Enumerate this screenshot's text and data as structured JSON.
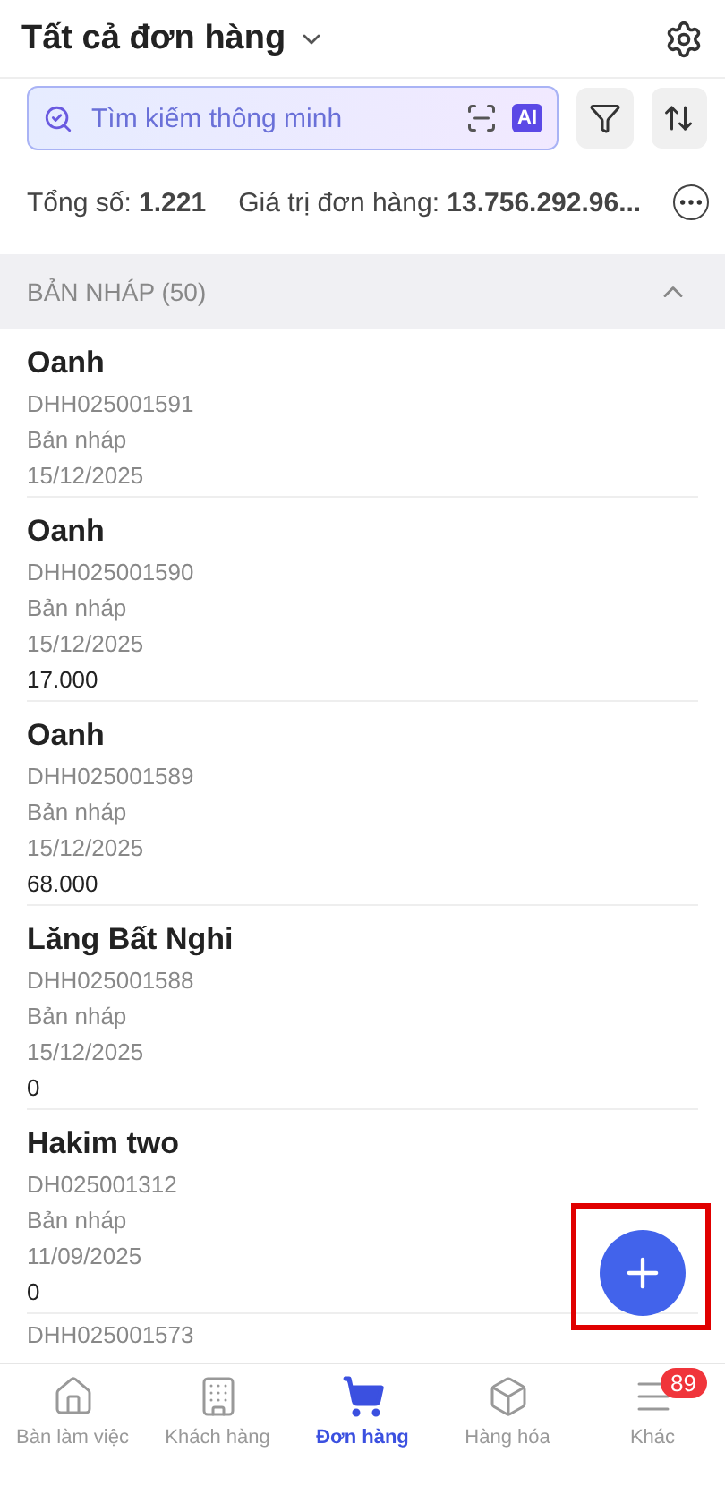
{
  "header": {
    "title": "Tất cả đơn hàng"
  },
  "search": {
    "placeholder": "Tìm kiếm thông minh",
    "ai_badge": "AI"
  },
  "summary": {
    "total_label": "Tổng số:",
    "total_value": "1.221",
    "value_label": "Giá trị đơn hàng:",
    "value_value": "13.756.292.96..."
  },
  "section": {
    "title": "BẢN NHÁP (50)",
    "expanded": true
  },
  "orders": [
    {
      "customer": "Oanh",
      "code": "DHH025001591",
      "status": "Bản nháp",
      "date": "15/12/2025"
    },
    {
      "customer": "Oanh",
      "code": "DHH025001590",
      "status": "Bản nháp",
      "date": "15/12/2025",
      "amount": "17.000"
    },
    {
      "customer": "Oanh",
      "code": "DHH025001589",
      "status": "Bản nháp",
      "date": "15/12/2025",
      "amount": "68.000"
    },
    {
      "customer": "Lăng Bất Nghi",
      "code": "DHH025001588",
      "status": "Bản nháp",
      "date": "15/12/2025",
      "amount": "0"
    },
    {
      "customer": "Hakim two",
      "code": "DH025001312",
      "status": "Bản nháp",
      "date": "11/09/2025",
      "amount": "0"
    }
  ],
  "partial_order": {
    "code": "DHH025001573"
  },
  "fab": {
    "highlighted": true
  },
  "tabs": [
    {
      "kind": "home",
      "label": "Bàn làm việc",
      "selected": false
    },
    {
      "kind": "building",
      "label": "Khách hàng",
      "selected": false
    },
    {
      "kind": "cart",
      "label": "Đơn hàng",
      "selected": true
    },
    {
      "kind": "box",
      "label": "Hàng hóa",
      "selected": false
    },
    {
      "kind": "menu",
      "label": "Khác",
      "selected": false,
      "badge": "89"
    }
  ]
}
